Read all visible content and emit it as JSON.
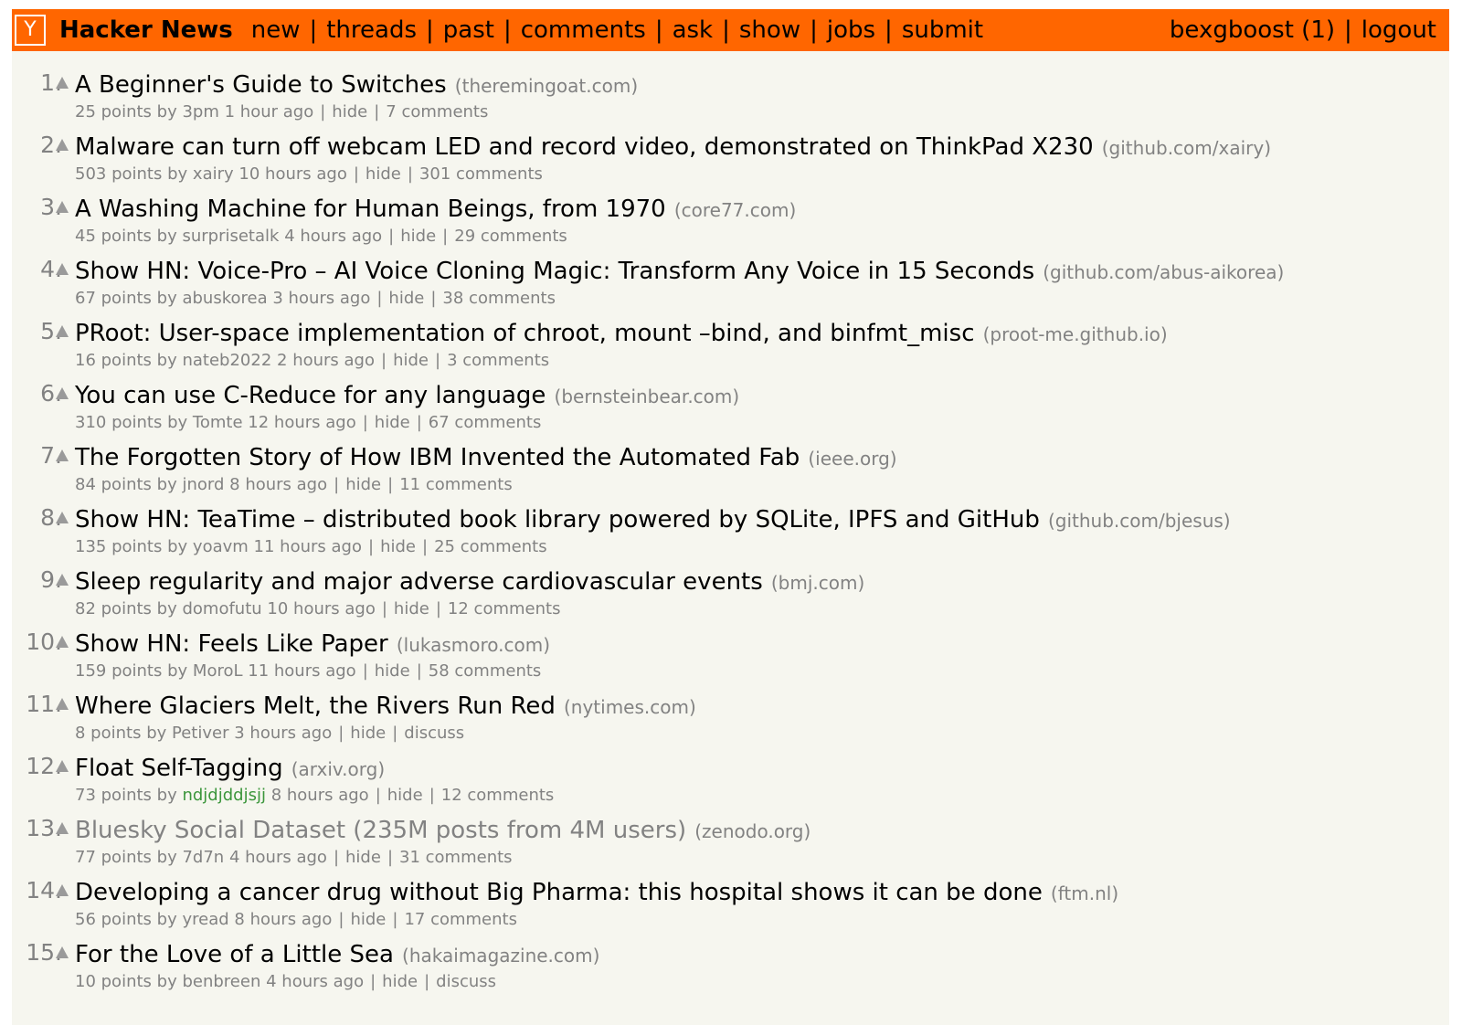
{
  "header": {
    "logo_text": "Y",
    "site_name": "Hacker News",
    "nav": [
      "new",
      "threads",
      "past",
      "comments",
      "ask",
      "show",
      "jobs",
      "submit"
    ],
    "nav_separator": "|",
    "user": "bexgboost",
    "karma": "(1)",
    "logout": "logout",
    "colors": {
      "bar": "#ff6600",
      "page_bg": "#f6f6ef",
      "meta": "#828282"
    }
  },
  "vote_icon": "upvote-arrow",
  "stories": [
    {
      "rank": "1.",
      "title": "A Beginner's Guide to Switches",
      "site": "(theremingoat.com)",
      "points": "25 points",
      "by": "by",
      "user": "3pm",
      "age": "1 hour ago",
      "hide": "hide",
      "comments": "7 comments"
    },
    {
      "rank": "2.",
      "title": "Malware can turn off webcam LED and record video, demonstrated on ThinkPad X230",
      "site": "(github.com/xairy)",
      "points": "503 points",
      "by": "by",
      "user": "xairy",
      "age": "10 hours ago",
      "hide": "hide",
      "comments": "301 comments"
    },
    {
      "rank": "3.",
      "title": "A Washing Machine for Human Beings, from 1970",
      "site": "(core77.com)",
      "points": "45 points",
      "by": "by",
      "user": "surprisetalk",
      "age": "4 hours ago",
      "hide": "hide",
      "comments": "29 comments"
    },
    {
      "rank": "4.",
      "title": "Show HN: Voice-Pro – AI Voice Cloning Magic: Transform Any Voice in 15 Seconds",
      "site": "(github.com/abus-aikorea)",
      "points": "67 points",
      "by": "by",
      "user": "abuskorea",
      "age": "3 hours ago",
      "hide": "hide",
      "comments": "38 comments"
    },
    {
      "rank": "5.",
      "title": "PRoot: User-space implementation of chroot, mount –bind, and binfmt_misc",
      "site": "(proot-me.github.io)",
      "points": "16 points",
      "by": "by",
      "user": "nateb2022",
      "age": "2 hours ago",
      "hide": "hide",
      "comments": "3 comments"
    },
    {
      "rank": "6.",
      "title": "You can use C-Reduce for any language",
      "site": "(bernsteinbear.com)",
      "points": "310 points",
      "by": "by",
      "user": "Tomte",
      "age": "12 hours ago",
      "hide": "hide",
      "comments": "67 comments"
    },
    {
      "rank": "7.",
      "title": "The Forgotten Story of How IBM Invented the Automated Fab",
      "site": "(ieee.org)",
      "points": "84 points",
      "by": "by",
      "user": "jnord",
      "age": "8 hours ago",
      "hide": "hide",
      "comments": "11 comments"
    },
    {
      "rank": "8.",
      "title": "Show HN: TeaTime – distributed book library powered by SQLite, IPFS and GitHub",
      "site": "(github.com/bjesus)",
      "points": "135 points",
      "by": "by",
      "user": "yoavm",
      "age": "11 hours ago",
      "hide": "hide",
      "comments": "25 comments"
    },
    {
      "rank": "9.",
      "title": "Sleep regularity and major adverse cardiovascular events",
      "site": "(bmj.com)",
      "points": "82 points",
      "by": "by",
      "user": "domofutu",
      "age": "10 hours ago",
      "hide": "hide",
      "comments": "12 comments"
    },
    {
      "rank": "10.",
      "title": "Show HN: Feels Like Paper",
      "site": "(lukasmoro.com)",
      "points": "159 points",
      "by": "by",
      "user": "MoroL",
      "age": "11 hours ago",
      "hide": "hide",
      "comments": "58 comments"
    },
    {
      "rank": "11.",
      "title": "Where Glaciers Melt, the Rivers Run Red",
      "site": "(nytimes.com)",
      "points": "8 points",
      "by": "by",
      "user": "Petiver",
      "age": "3 hours ago",
      "hide": "hide",
      "comments": "discuss"
    },
    {
      "rank": "12.",
      "title": "Float Self-Tagging",
      "site": "(arxiv.org)",
      "points": "73 points",
      "by": "by",
      "user": "ndjdjddjsjj",
      "user_new": true,
      "age": "8 hours ago",
      "hide": "hide",
      "comments": "12 comments"
    },
    {
      "rank": "13.",
      "title": "Bluesky Social Dataset (235M posts from 4M users)",
      "visited": true,
      "site": "(zenodo.org)",
      "points": "77 points",
      "by": "by",
      "user": "7d7n",
      "age": "4 hours ago",
      "hide": "hide",
      "comments": "31 comments"
    },
    {
      "rank": "14.",
      "title": "Developing a cancer drug without Big Pharma: this hospital shows it can be done",
      "site": "(ftm.nl)",
      "points": "56 points",
      "by": "by",
      "user": "yread",
      "age": "8 hours ago",
      "hide": "hide",
      "comments": "17 comments"
    },
    {
      "rank": "15.",
      "title": "For the Love of a Little Sea",
      "site": "(hakaimagazine.com)",
      "points": "10 points",
      "by": "by",
      "user": "benbreen",
      "age": "4 hours ago",
      "hide": "hide",
      "comments": "discuss"
    }
  ]
}
